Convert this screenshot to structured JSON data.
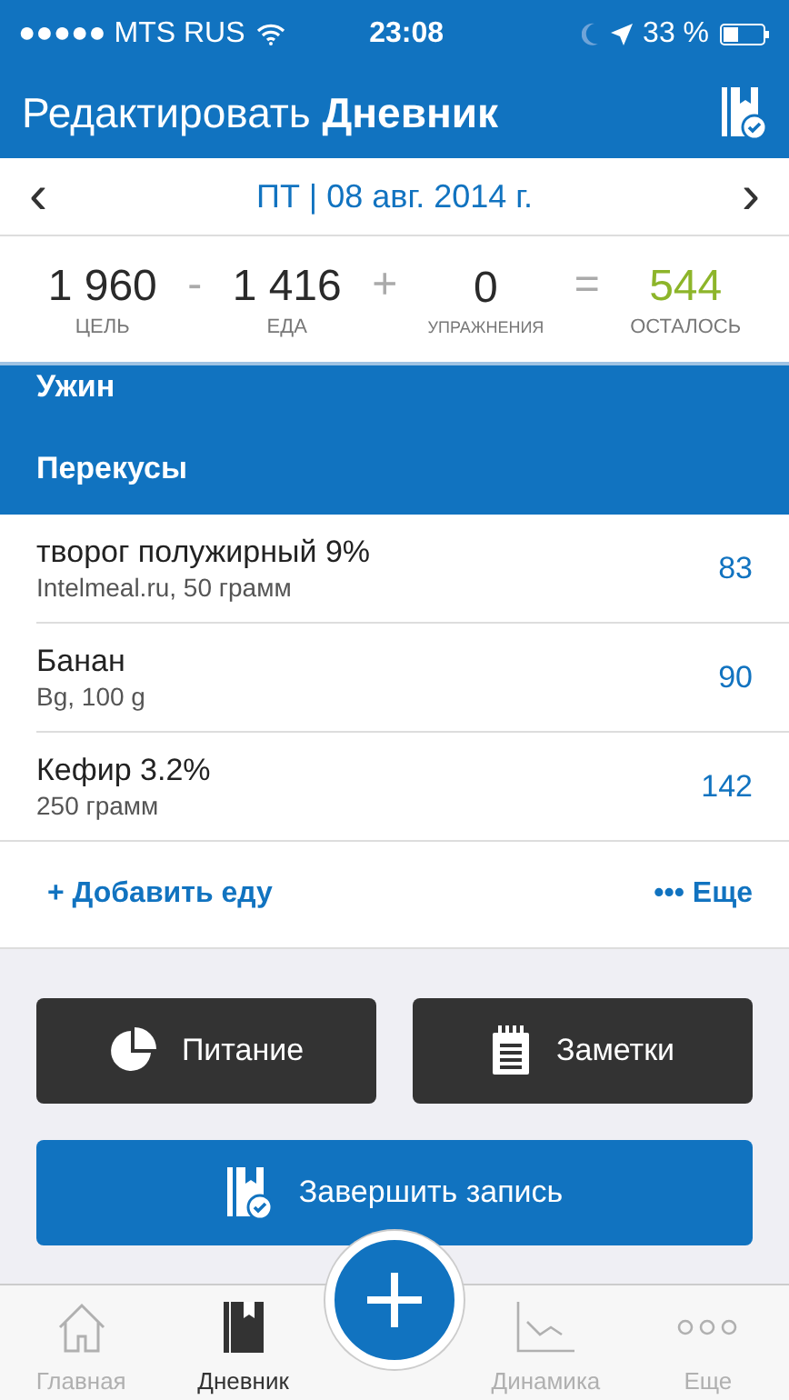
{
  "status_bar": {
    "carrier": "●●●●● MTS RUS",
    "time": "23:08",
    "battery": "33 %"
  },
  "header": {
    "title": "Редактировать **Дневник**"
  },
  "date_nav": {
    "prev": "‹",
    "date": "ПТ | 08 авг. 2014 г.",
    "next": "›"
  },
  "summary": {
    "items": [
      {
        "value": "1 960",
        "label": "ЦЕЛЬ",
        "color": "#2a2a2a"
      },
      {
        "value": "1 416",
        "label": "ЕДА",
        "color": "#2a2a2a"
      },
      {
        "value": "0",
        "label": "УПРАЖНЕНИЯ",
        "color": "#2a2a2a"
      },
      {
        "value": "544",
        "label": "ОСТАЛОСЬ",
        "color": "#8db52a"
      }
    ],
    "operators": [
      "-",
      "+",
      "="
    ]
  },
  "sections": [
    {
      "title": "Ужин",
      "cut": true
    },
    {
      "title": "Перекусы",
      "cut": false
    }
  ],
  "entries": [
    {
      "name": "творог полужирный 9%",
      "detail": "Intelmeal.ru, 50 грамм",
      "calories": "83"
    },
    {
      "name": "Банан",
      "detail": "Bg, 100 g",
      "calories": "90"
    },
    {
      "name": "Кефир 3.2%",
      "detail": "250 грамм",
      "calories": "142"
    }
  ],
  "add_food": "+ Добавить еду",
  "more": "••• Еще",
  "buttons": [
    {
      "label": "Питание",
      "kind": "nutrition"
    },
    {
      "label": "Заметки",
      "kind": "notes"
    },
    {
      "label": "Завершить запись",
      "kind": "complete"
    }
  ],
  "tab_bar": [
    {
      "label": "Главная",
      "kind": "home",
      "selected": false
    },
    {
      "label": "Дневник",
      "kind": "diary",
      "selected": true
    },
    {
      "label": "Динамика",
      "kind": "progress",
      "selected": false
    },
    {
      "label": "Еще",
      "kind": "more",
      "selected": false
    }
  ]
}
